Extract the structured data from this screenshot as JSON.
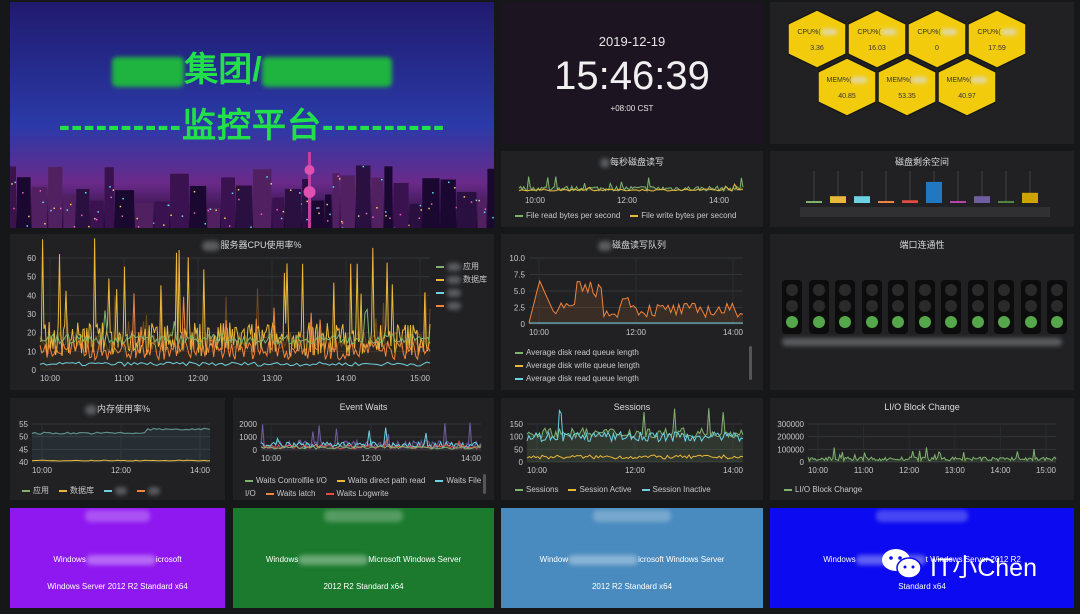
{
  "banner": {
    "line1_mid": "集团/",
    "line2": "----------监控平台----------"
  },
  "clock": {
    "date": "2019-12-19",
    "time": "15:46:39",
    "tz": "+08:00 CST"
  },
  "honeycomb": {
    "cpu": [
      {
        "label": "CPU%(",
        "value": "3.36"
      },
      {
        "label": "CPU%(",
        "value": "16.03"
      },
      {
        "label": "CPU%(",
        "value": "0"
      },
      {
        "label": "CPU%(",
        "value": "17.59"
      }
    ],
    "mem": [
      {
        "label": "MEM%(",
        "value": "40.85"
      },
      {
        "label": "MEM%(",
        "value": "53.35"
      },
      {
        "label": "MEM%(",
        "value": "40.97"
      }
    ],
    "color": "#f2cc0c"
  },
  "disk_rw": {
    "title": "每秒磁盘读写",
    "x_ticks": [
      "10:00",
      "12:00",
      "14:00"
    ],
    "legend": [
      {
        "name": "File read bytes per second",
        "color": "#7eb26d"
      },
      {
        "name": "File write bytes per second",
        "color": "#eab839"
      }
    ]
  },
  "disk_free": {
    "title": "磁盘剩余空间",
    "bars": [
      {
        "value": 0.04,
        "color": "#7eb26d"
      },
      {
        "value": 0.2,
        "color": "#eab839"
      },
      {
        "value": 0.2,
        "color": "#6ed0e0"
      },
      {
        "value": 0.05,
        "color": "#ef843c"
      },
      {
        "value": 0.08,
        "color": "#e24d42"
      },
      {
        "value": 0.62,
        "color": "#1f78c1"
      },
      {
        "value": 0.05,
        "color": "#ba43a9"
      },
      {
        "value": 0.2,
        "color": "#705da0"
      },
      {
        "value": 0.06,
        "color": "#508642"
      },
      {
        "value": 0.3,
        "color": "#cca300"
      }
    ]
  },
  "cpu_usage": {
    "title": "服务器CPU使用率%",
    "y_ticks": [
      "60",
      "50",
      "40",
      "30",
      "20",
      "10",
      "0"
    ],
    "x_ticks": [
      "10:00",
      "11:00",
      "12:00",
      "13:00",
      "14:00",
      "15:00"
    ],
    "legend": [
      {
        "name": "应用",
        "color": "#7eb26d"
      },
      {
        "name": "数据库",
        "color": "#eab839"
      },
      {
        "name": "",
        "color": "#6ed0e0"
      },
      {
        "name": "",
        "color": "#ef843c"
      }
    ]
  },
  "disk_queue": {
    "title": "磁盘读写队列",
    "y_ticks": [
      "10.0",
      "7.5",
      "5.0",
      "2.5",
      "0"
    ],
    "x_ticks": [
      "10:00",
      "12:00",
      "14:00"
    ],
    "legend": [
      {
        "name": "Average disk read queue length",
        "color": "#7eb26d"
      },
      {
        "name": "Average disk write queue length",
        "color": "#eab839"
      },
      {
        "name": "Average disk read queue length",
        "color": "#6ed0e0"
      }
    ]
  },
  "port": {
    "title": "端口连通性",
    "lights": 11
  },
  "memory": {
    "title": "内存使用率%",
    "y_ticks": [
      "55",
      "50",
      "45",
      "40"
    ],
    "x_ticks": [
      "10:00",
      "12:00",
      "14:00"
    ],
    "legend": [
      {
        "name": "应用",
        "color": "#7eb26d"
      },
      {
        "name": "数据库",
        "color": "#eab839"
      },
      {
        "name": "",
        "color": "#6ed0e0"
      },
      {
        "name": "",
        "color": "#ef843c"
      }
    ]
  },
  "event_waits": {
    "title": "Event Waits",
    "y_ticks": [
      "2000",
      "1000",
      "0"
    ],
    "x_ticks": [
      "10:00",
      "12:00",
      "14:00"
    ],
    "legend": [
      {
        "name": "Waits Controlfile I/O",
        "color": "#7eb26d"
      },
      {
        "name": "Waits direct path read",
        "color": "#eab839"
      },
      {
        "name": "Waits File I/O",
        "color": "#6ed0e0"
      },
      {
        "name": "Waits latch",
        "color": "#ef843c"
      },
      {
        "name": "Waits Logwrite",
        "color": "#e24d42"
      }
    ]
  },
  "sessions": {
    "title": "Sessions",
    "y_ticks": [
      "150",
      "100",
      "50",
      "0"
    ],
    "x_ticks": [
      "10:00",
      "12:00",
      "14:00"
    ],
    "legend": [
      {
        "name": "Sessions",
        "color": "#7eb26d"
      },
      {
        "name": "Session Active",
        "color": "#eab839"
      },
      {
        "name": "Session Inactive",
        "color": "#6ed0e0"
      }
    ]
  },
  "io_block": {
    "title": "LI/O Block Change",
    "y_ticks": [
      "300000",
      "200000",
      "100000",
      "0"
    ],
    "x_ticks": [
      "10:00",
      "11:00",
      "12:00",
      "13:00",
      "14:00",
      "15:00"
    ],
    "legend": [
      {
        "name": "LI/O Block Change",
        "color": "#7eb26d"
      }
    ]
  },
  "os_cards": [
    {
      "line1_a": "Windows",
      "line1_b": "icrosoft",
      "line2": "Windows Server 2012 R2 Standard x64",
      "color": "#8f18f0"
    },
    {
      "line1_a": "Windows",
      "line1_b": "Microsoft Windows Server",
      "line2": "2012 R2 Standard x64",
      "color": "#1c7a2e"
    },
    {
      "line1_a": "Window",
      "line1_b": "icrosoft Windows Server",
      "line2": "2012 R2 Standard x64",
      "color": "#4a8bbf"
    },
    {
      "line1_a": "Windows",
      "line1_b": "t Windows Server 2012 R2",
      "line2": "Standard x64",
      "color": "#0b0af0"
    }
  ],
  "watermark": {
    "text": "IT小Chen"
  }
}
